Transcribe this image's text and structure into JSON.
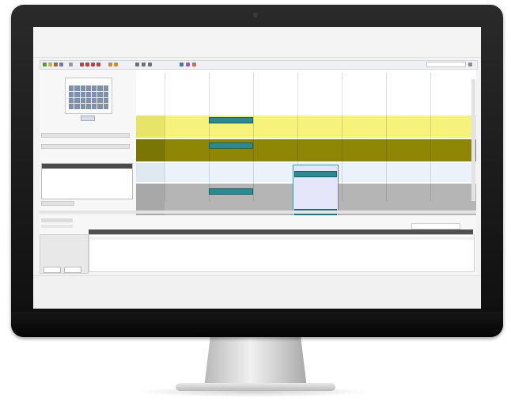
{
  "colors": {
    "bezel": "#121212",
    "stand": "#d6d6d6",
    "yellow_light": "#f6f27a",
    "yellow_olive": "#8e8706",
    "light_blue": "#eaf3fb",
    "gray_band": "#b5b5b5",
    "event_teal": "#2a8a8f"
  },
  "toolbar": {
    "icons": [
      "calendar-icon",
      "new-icon",
      "open-icon",
      "save-icon",
      "print-icon",
      "cut-icon",
      "copy-icon",
      "paste-icon",
      "delete-icon",
      "undo-icon",
      "redo-icon",
      "find-icon",
      "zoom-in-icon",
      "zoom-out-icon",
      "refresh-icon"
    ],
    "view_dropdown_value": ""
  },
  "left_panel": {
    "mini_calendar_title": "",
    "today_label": "",
    "filter_label": "",
    "details_rows": [
      "",
      "",
      "",
      "",
      ""
    ]
  },
  "calendar": {
    "day_headers": [
      "",
      "",
      "",
      "",
      "",
      "",
      ""
    ],
    "resources": [
      {
        "name": "",
        "color": "#f6f27a"
      },
      {
        "name": "",
        "color": "#8e8706"
      },
      {
        "name": "",
        "color": "#eaf3fb"
      },
      {
        "name": "",
        "color": "#b5b5b5"
      }
    ],
    "selected_event_label": ""
  },
  "bottom": {
    "tab_label": "",
    "rows": [
      "",
      "",
      ""
    ],
    "buttons": [
      "",
      ""
    ]
  }
}
